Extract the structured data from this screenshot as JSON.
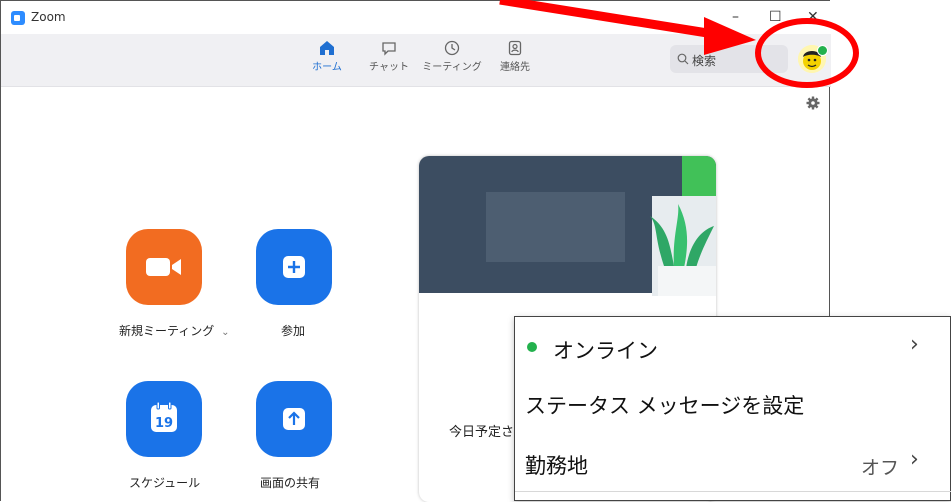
{
  "window": {
    "title": "Zoom",
    "minimize": "–",
    "maximize": "☐",
    "close": "✕"
  },
  "tabs": [
    {
      "label": "ホーム",
      "icon": "home-icon",
      "active": true
    },
    {
      "label": "チャット",
      "icon": "chat-icon"
    },
    {
      "label": "ミーティング",
      "icon": "clock-icon"
    },
    {
      "label": "連絡先",
      "icon": "contacts-icon"
    }
  ],
  "search": {
    "label": "検索",
    "icon": "search-icon"
  },
  "avatar": {
    "status": "online",
    "status_color": "#23b14d"
  },
  "actions": [
    {
      "label": "新規ミーティング",
      "caret": "⌄",
      "icon": "video-camera-icon",
      "color": "#f26c21"
    },
    {
      "label": "参加",
      "icon": "plus-icon",
      "color": "#1a73e8"
    },
    {
      "label": "スケジュール",
      "icon": "calendar-icon",
      "day": "19",
      "color": "#1a73e8"
    },
    {
      "label": "画面の共有",
      "icon": "share-up-arrow-icon",
      "color": "#1a73e8"
    }
  ],
  "card": {
    "today_text": "今日予定さ"
  },
  "status_menu": {
    "items": [
      {
        "label": "オンライン",
        "indicator_color": "#23b14d",
        "chevron": "›"
      },
      {
        "label": "ステータス メッセージを設定"
      },
      {
        "label": "勤務地",
        "value": "オフ",
        "chevron": "›"
      }
    ]
  },
  "annotation": {
    "color": "#ff0000"
  }
}
